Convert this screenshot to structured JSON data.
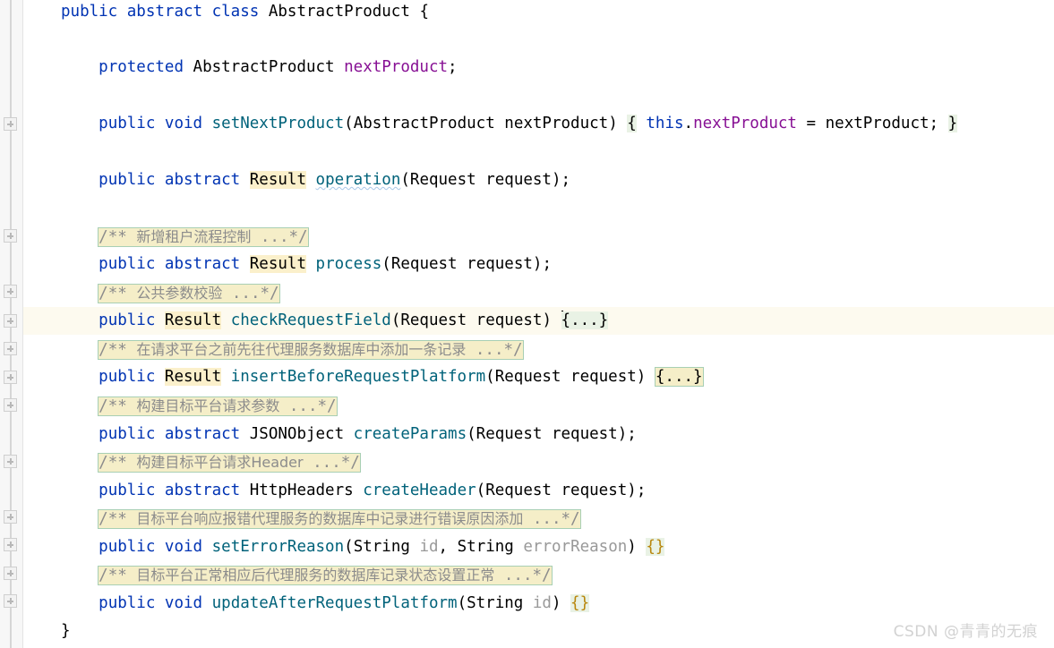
{
  "app": {
    "kind": "code-editor",
    "language": "java",
    "file_class": "AbstractProduct"
  },
  "theme": {
    "background": "#ffffff",
    "gutter_background": "#f7f7f7",
    "keyword_color": "#0033b3",
    "method_color": "#00627a",
    "field_color": "#871094",
    "dim_param_color": "#999999",
    "identifier_highlight": "#fbf0cb",
    "fold_region_fill": "#f5eec8",
    "fold_region_border": "#a8cfb4",
    "fold_brace_fill": "#e9f2e5",
    "caret_line_background": "#fdfaef",
    "text_color": "#000000",
    "watermark_color": "#d2d2d2"
  },
  "gutter": {
    "fold_marker_icon": "fold-plus-icon",
    "marker_count": 13
  },
  "caret": {
    "line_index": 9,
    "visible": true
  },
  "watermark": {
    "text": "CSDN @青青的无痕"
  },
  "code_lines": [
    {
      "index": 0,
      "text": "public abstract class AbstractProduct {"
    },
    {
      "index": 1,
      "text": ""
    },
    {
      "index": 2,
      "text": "    protected AbstractProduct nextProduct;"
    },
    {
      "index": 3,
      "text": ""
    },
    {
      "index": 4,
      "text": "    public void setNextProduct(AbstractProduct nextProduct) { this.nextProduct = nextProduct; }"
    },
    {
      "index": 5,
      "text": ""
    },
    {
      "index": 6,
      "text": "    public abstract Result operation(Request request);"
    },
    {
      "index": 7,
      "text": ""
    },
    {
      "index": 8,
      "text": "    /** 新增租户流程控制 ...*/"
    },
    {
      "index": 9,
      "text": "    public abstract Result process(Request request);"
    },
    {
      "index": 10,
      "text": "    /** 公共参数校验 ...*/"
    },
    {
      "index": 11,
      "text": "    public Result checkRequestField(Request request) {...}"
    },
    {
      "index": 12,
      "text": "    /** 在请求平台之前先往代理服务数据库中添加一条记录 ...*/"
    },
    {
      "index": 13,
      "text": "    public Result insertBeforeRequestPlatform(Request request) {...}"
    },
    {
      "index": 14,
      "text": "    /** 构建目标平台请求参数 ...*/"
    },
    {
      "index": 15,
      "text": "    public abstract JSONObject createParams(Request request);"
    },
    {
      "index": 16,
      "text": "    /** 构建目标平台请求Header ...*/"
    },
    {
      "index": 17,
      "text": "    public abstract HttpHeaders createHeader(Request request);"
    },
    {
      "index": 18,
      "text": "    /** 目标平台响应报错代理服务的数据库中记录进行错误原因添加 ...*/"
    },
    {
      "index": 19,
      "text": "    public void setErrorReason(String id, String errorReason) {}"
    },
    {
      "index": 20,
      "text": "    /** 目标平台正常相应后代理服务的数据库记录状态设置正常 ...*/"
    },
    {
      "index": 21,
      "text": "    public void updateAfterRequestPlatform(String id) {}"
    },
    {
      "index": 22,
      "text": "}"
    }
  ],
  "tokens": {
    "kw_public": "public",
    "kw_abstract": "abstract",
    "kw_class": "class",
    "kw_protected": "protected",
    "kw_void": "void",
    "kw_this": "this",
    "type_abstractproduct": "AbstractProduct",
    "type_result": "Result",
    "type_request": "Request",
    "type_string": "String",
    "type_jsonobject": "JSONObject",
    "type_httpheaders": "HttpHeaders",
    "field_nextproduct": "nextProduct",
    "m_setnextproduct": "setNextProduct",
    "m_operation": "operation",
    "m_process": "process",
    "m_checkrequestfield": "checkRequestField",
    "m_insertbeforerequestplatform": "insertBeforeRequestPlatform",
    "m_createparams": "createParams",
    "m_createheader": "createHeader",
    "m_seterrorreason": "setErrorReason",
    "m_updateafterrequestplatform": "updateAfterRequestPlatform",
    "p_request": "request",
    "p_id": "id",
    "p_errorreason": "errorReason",
    "collapsed_body": "{...}",
    "empty_body": "{}",
    "brace_open": "{",
    "brace_close": "}",
    "comment_open": "/**",
    "comment_close": "...*/"
  },
  "comments": [
    {
      "index": 0,
      "text": "新增租户流程控制"
    },
    {
      "index": 1,
      "text": "公共参数校验"
    },
    {
      "index": 2,
      "text": "在请求平台之前先往代理服务数据库中添加一条记录"
    },
    {
      "index": 3,
      "text": "构建目标平台请求参数"
    },
    {
      "index": 4,
      "text": "构建目标平台请求Header"
    },
    {
      "index": 5,
      "text": "目标平台响应报错代理服务的数据库中记录进行错误原因添加"
    },
    {
      "index": 6,
      "text": "目标平台正常相应后代理服务的数据库记录状态设置正常"
    }
  ]
}
